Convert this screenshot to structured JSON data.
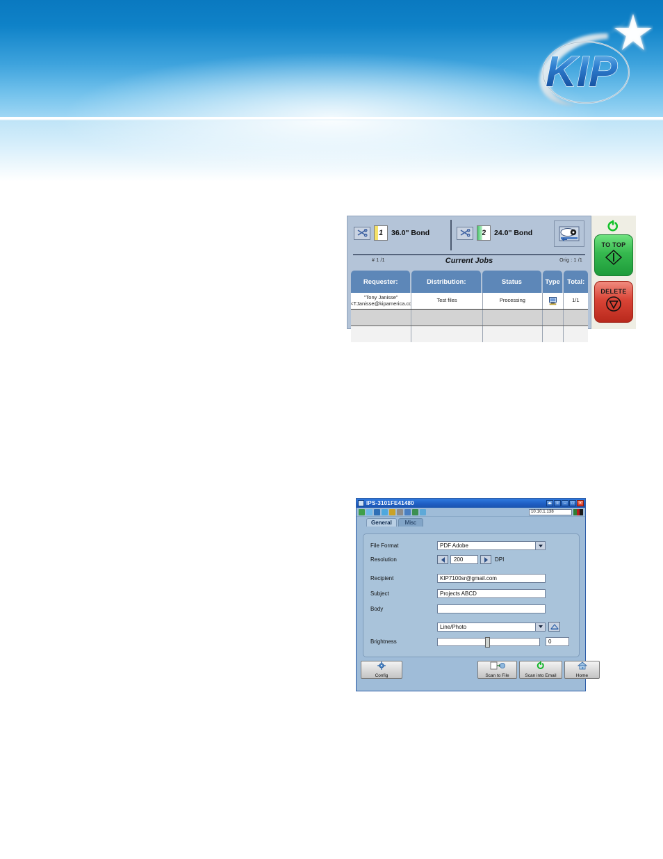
{
  "page": {
    "brand": "KIP",
    "banner_accent": "#0f82c8"
  },
  "touchscreen": {
    "rolls": [
      {
        "number": "1",
        "label": "36.0'' Bond",
        "cut_icon": "scissors-icon",
        "stripe_color": "#f5e26a"
      },
      {
        "number": "2",
        "label": "24.0'' Bond",
        "cut_icon": "scissors-icon",
        "stripe_color": "#47c36a"
      }
    ],
    "media_button_icon": "media-roll-icon",
    "queue_count_left": "# 1 /1",
    "queue_title": "Current Jobs",
    "queue_count_right": "Orig : 1 /1",
    "columns": [
      "Requester:",
      "Distribution:",
      "Status",
      "Type",
      "Total:"
    ],
    "rows": [
      {
        "requester_line1": "\"Tony Janisse\"",
        "requester_line2": "<TJanisse@kipamerica.co",
        "distribution": "Test files",
        "status": "Processing",
        "type_icon": "computer-icon",
        "total": "1/1"
      }
    ],
    "status_led_icon": "power-ring-icon",
    "buttons": [
      {
        "label": "TO TOP",
        "icon": "start-diamond-icon",
        "color": "#1e9b3a"
      },
      {
        "label": "DELETE",
        "icon": "stop-circle-icon",
        "color": "#b9291c"
      }
    ]
  },
  "scan_dialog": {
    "title": "IPS-3101FE41480",
    "title_icon": "window-icon",
    "window_buttons": [
      {
        "name": "restore-down-button",
        "glyph": "◂▸"
      },
      {
        "name": "menu-button",
        "glyph": "≡"
      },
      {
        "name": "minimize-button",
        "glyph": "–"
      },
      {
        "name": "maximize-button",
        "glyph": "□"
      },
      {
        "name": "close-button",
        "glyph": "✕"
      }
    ],
    "toolbar_icons": [
      {
        "name": "connect-icon",
        "color": "#3f9f4a"
      },
      {
        "name": "monitor-icon",
        "color": "#6fb8e8"
      },
      {
        "name": "globe-icon",
        "color": "#2f6fb5"
      },
      {
        "name": "refresh-icon",
        "color": "#4ea8dd"
      },
      {
        "name": "network-icon",
        "color": "#c9a227"
      },
      {
        "name": "tools-icon",
        "color": "#8c8c8c"
      },
      {
        "name": "info-icon",
        "color": "#4a7fc1"
      },
      {
        "name": "settings-globe-icon",
        "color": "#3c8f52"
      },
      {
        "name": "filter-icon",
        "color": "#5ea9d8"
      }
    ],
    "ip_address": "10.10.1.138",
    "signal_swatch": [
      "#2e7d32",
      "#b71c1c",
      "#1b1b1b"
    ],
    "tabs": [
      {
        "label": "General",
        "active": true
      },
      {
        "label": "Misc",
        "active": false
      }
    ],
    "fields": {
      "file_format_label": "File Format",
      "file_format_value": "PDF Adobe",
      "resolution_label": "Resolution",
      "resolution_value": "200",
      "resolution_unit": "DPI",
      "recipient_label": "Recipient",
      "recipient_value": "KIP7100sr@gmail.com",
      "subject_label": "Subject",
      "subject_value": "Projects ABCD",
      "body_label": "Body",
      "body_value": "",
      "mode_value": "Line/Photo",
      "mode_edit_icon": "image-adjust-icon",
      "brightness_label": "Brightness",
      "brightness_value": "0"
    },
    "actions": [
      {
        "label": "Config",
        "icon": "gear-icon"
      },
      {
        "label": "Scan to File",
        "icon": "scan-to-file-icon"
      },
      {
        "label": "Scan into Email",
        "icon": "scan-to-email-icon"
      },
      {
        "label": "Home",
        "icon": "home-icon"
      }
    ]
  }
}
